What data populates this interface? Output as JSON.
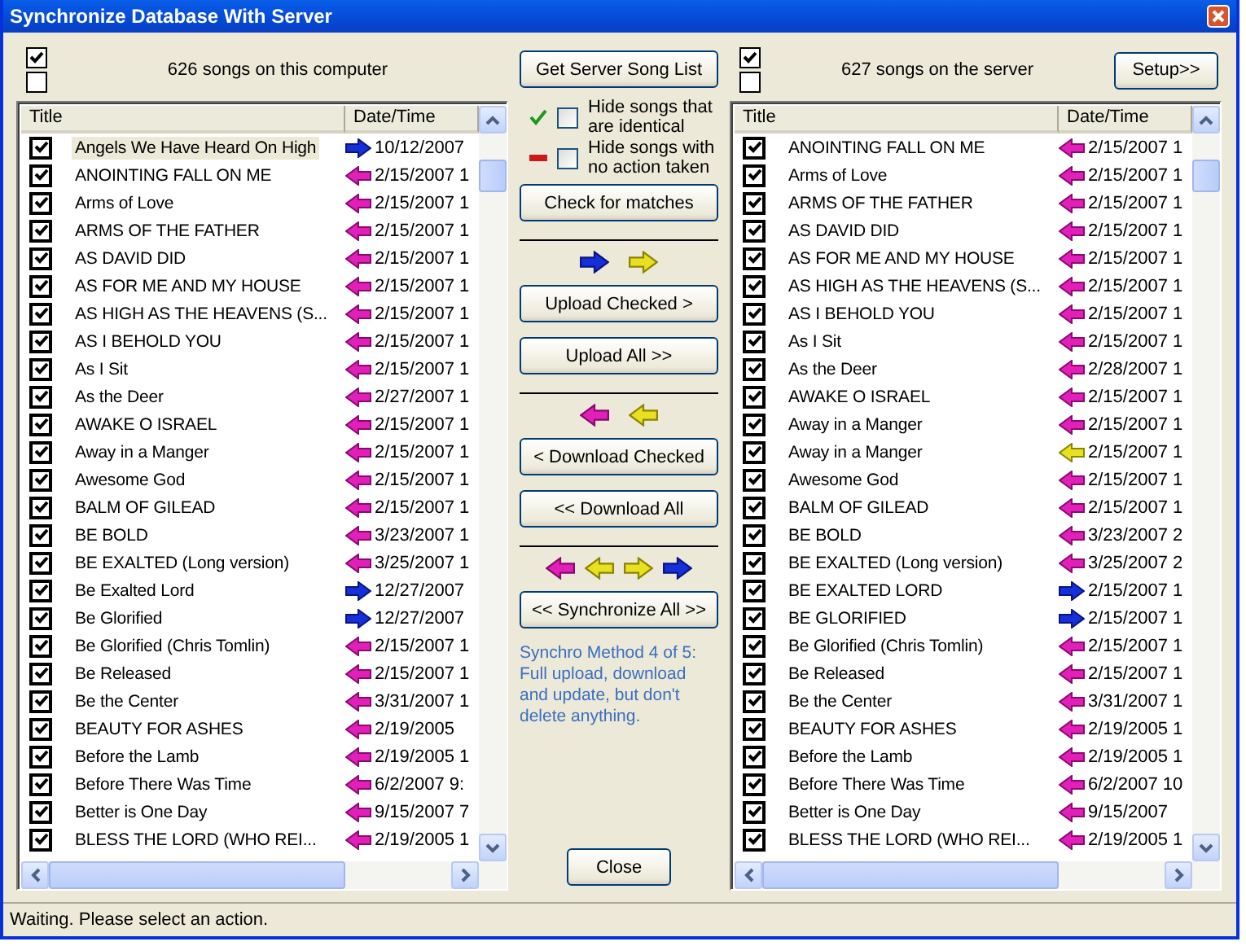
{
  "window": {
    "title": "Synchronize Database With Server"
  },
  "local": {
    "select_boxes": [
      {
        "checked": true
      },
      {
        "checked": false
      }
    ],
    "count": "626 songs on this computer",
    "columns": [
      "Title",
      "Date/Time"
    ],
    "rows": [
      {
        "title": "Angels We Have Heard On High",
        "kind": "upload",
        "date": "10/12/2007",
        "checked": true,
        "selected": true
      },
      {
        "title": "ANOINTING FALL ON ME",
        "kind": "download",
        "date": "2/15/2007 1",
        "checked": true,
        "selected": false
      },
      {
        "title": "Arms of Love",
        "kind": "download",
        "date": "2/15/2007 1",
        "checked": true,
        "selected": false
      },
      {
        "title": "ARMS OF THE FATHER",
        "kind": "download",
        "date": "2/15/2007 1",
        "checked": true,
        "selected": false
      },
      {
        "title": "AS DAVID DID",
        "kind": "download",
        "date": "2/15/2007 1",
        "checked": true,
        "selected": false
      },
      {
        "title": "AS FOR ME AND MY HOUSE",
        "kind": "download",
        "date": "2/15/2007 1",
        "checked": true,
        "selected": false
      },
      {
        "title": "AS HIGH AS THE HEAVENS (S...",
        "kind": "download",
        "date": "2/15/2007 1",
        "checked": true,
        "selected": false
      },
      {
        "title": "AS I BEHOLD YOU",
        "kind": "download",
        "date": "2/15/2007 1",
        "checked": true,
        "selected": false
      },
      {
        "title": "As I Sit",
        "kind": "download",
        "date": "2/15/2007 1",
        "checked": true,
        "selected": false
      },
      {
        "title": "As the Deer",
        "kind": "download",
        "date": "2/27/2007 1",
        "checked": true,
        "selected": false
      },
      {
        "title": "AWAKE O ISRAEL",
        "kind": "download",
        "date": "2/15/2007 1",
        "checked": true,
        "selected": false
      },
      {
        "title": "Away in a Manger",
        "kind": "download",
        "date": "2/15/2007 1",
        "checked": true,
        "selected": false
      },
      {
        "title": "Awesome God",
        "kind": "download",
        "date": "2/15/2007 1",
        "checked": true,
        "selected": false
      },
      {
        "title": "BALM OF GILEAD",
        "kind": "download",
        "date": "2/15/2007 1",
        "checked": true,
        "selected": false
      },
      {
        "title": "BE BOLD",
        "kind": "download",
        "date": "3/23/2007 1",
        "checked": true,
        "selected": false
      },
      {
        "title": "BE EXALTED (Long version)",
        "kind": "download",
        "date": "3/25/2007 1",
        "checked": true,
        "selected": false
      },
      {
        "title": "Be Exalted Lord",
        "kind": "upload",
        "date": "12/27/2007",
        "checked": true,
        "selected": false
      },
      {
        "title": "Be Glorified",
        "kind": "upload",
        "date": "12/27/2007",
        "checked": true,
        "selected": false
      },
      {
        "title": "Be Glorified (Chris Tomlin)",
        "kind": "download",
        "date": "2/15/2007 1",
        "checked": true,
        "selected": false
      },
      {
        "title": "Be Released",
        "kind": "download",
        "date": "2/15/2007 1",
        "checked": true,
        "selected": false
      },
      {
        "title": "Be the Center",
        "kind": "download",
        "date": "3/31/2007 1",
        "checked": true,
        "selected": false
      },
      {
        "title": "BEAUTY FOR ASHES",
        "kind": "download",
        "date": "2/19/2005",
        "checked": true,
        "selected": false
      },
      {
        "title": "Before the Lamb",
        "kind": "download",
        "date": "2/19/2005 1",
        "checked": true,
        "selected": false
      },
      {
        "title": "Before There Was Time",
        "kind": "download",
        "date": "6/2/2007 9:",
        "checked": true,
        "selected": false
      },
      {
        "title": "Better is One Day",
        "kind": "download",
        "date": "9/15/2007 7",
        "checked": true,
        "selected": false
      },
      {
        "title": "BLESS THE LORD (WHO REI...",
        "kind": "download",
        "date": "2/19/2005 1",
        "checked": true,
        "selected": false
      }
    ]
  },
  "middle": {
    "get_button": "Get Server Song List",
    "filters": [
      {
        "kind": "check",
        "label": "Hide songs that are identical",
        "checked": false
      },
      {
        "kind": "dash",
        "label": "Hide songs with no action taken",
        "checked": false
      }
    ],
    "check_button": "Check for matches",
    "sections": [
      {
        "arrows": [
          {
            "kind": "upload"
          },
          {
            "kind": "update-up"
          }
        ],
        "buttons": [
          "Upload Checked >",
          "Upload All >>"
        ]
      },
      {
        "arrows": [
          {
            "kind": "download"
          },
          {
            "kind": "update-down"
          }
        ],
        "buttons": [
          "< Download Checked",
          "<< Download All"
        ]
      },
      {
        "arrows": [
          {
            "kind": "download"
          },
          {
            "kind": "update-down"
          },
          {
            "kind": "update-up"
          },
          {
            "kind": "upload"
          }
        ],
        "buttons": [
          "<< Synchronize All >>"
        ]
      }
    ],
    "note": "Synchro Method 4 of 5: Full upload, download and update, but don't delete anything.",
    "close_button": "Close"
  },
  "server": {
    "select_boxes": [
      {
        "checked": true
      },
      {
        "checked": false
      }
    ],
    "count": "627 songs on the server",
    "setup_button": "Setup>>",
    "columns": [
      "Title",
      "Date/Time"
    ],
    "rows": [
      {
        "title": "ANOINTING FALL ON ME",
        "kind": "download",
        "date": "2/15/2007 1",
        "checked": true,
        "selected": false
      },
      {
        "title": "Arms of Love",
        "kind": "download",
        "date": "2/15/2007 1",
        "checked": true,
        "selected": false
      },
      {
        "title": "ARMS OF THE FATHER",
        "kind": "download",
        "date": "2/15/2007 1",
        "checked": true,
        "selected": false
      },
      {
        "title": "AS DAVID DID",
        "kind": "download",
        "date": "2/15/2007 1",
        "checked": true,
        "selected": false
      },
      {
        "title": "AS FOR ME AND MY HOUSE",
        "kind": "download",
        "date": "2/15/2007 1",
        "checked": true,
        "selected": false
      },
      {
        "title": "AS HIGH AS THE HEAVENS (S...",
        "kind": "download",
        "date": "2/15/2007 1",
        "checked": true,
        "selected": false
      },
      {
        "title": "AS I BEHOLD YOU",
        "kind": "download",
        "date": "2/15/2007 1",
        "checked": true,
        "selected": false
      },
      {
        "title": "As I Sit",
        "kind": "download",
        "date": "2/15/2007 1",
        "checked": true,
        "selected": false
      },
      {
        "title": "As the Deer",
        "kind": "download",
        "date": "2/28/2007 1",
        "checked": true,
        "selected": false
      },
      {
        "title": "AWAKE O ISRAEL",
        "kind": "download",
        "date": "2/15/2007 1",
        "checked": true,
        "selected": false
      },
      {
        "title": "Away in a Manger",
        "kind": "download",
        "date": "2/15/2007 1",
        "checked": true,
        "selected": false
      },
      {
        "title": "Away in a Manger",
        "kind": "update-down",
        "date": "2/15/2007 1",
        "checked": true,
        "selected": false
      },
      {
        "title": "Awesome God",
        "kind": "download",
        "date": "2/15/2007 1",
        "checked": true,
        "selected": false
      },
      {
        "title": "BALM OF GILEAD",
        "kind": "download",
        "date": "2/15/2007 1",
        "checked": true,
        "selected": false
      },
      {
        "title": "BE BOLD",
        "kind": "download",
        "date": "3/23/2007 2",
        "checked": true,
        "selected": false
      },
      {
        "title": "BE EXALTED (Long version)",
        "kind": "download",
        "date": "3/25/2007 2",
        "checked": true,
        "selected": false
      },
      {
        "title": "BE EXALTED LORD",
        "kind": "upload",
        "date": "2/15/2007 1",
        "checked": true,
        "selected": false
      },
      {
        "title": "BE GLORIFIED",
        "kind": "upload",
        "date": "2/15/2007 1",
        "checked": true,
        "selected": false
      },
      {
        "title": "Be Glorified (Chris Tomlin)",
        "kind": "download",
        "date": "2/15/2007 1",
        "checked": true,
        "selected": false
      },
      {
        "title": "Be Released",
        "kind": "download",
        "date": "2/15/2007 1",
        "checked": true,
        "selected": false
      },
      {
        "title": "Be the Center",
        "kind": "download",
        "date": "3/31/2007 1",
        "checked": true,
        "selected": false
      },
      {
        "title": "BEAUTY FOR ASHES",
        "kind": "download",
        "date": "2/19/2005 1",
        "checked": true,
        "selected": false
      },
      {
        "title": "Before the Lamb",
        "kind": "download",
        "date": "2/19/2005 1",
        "checked": true,
        "selected": false
      },
      {
        "title": "Before There Was Time",
        "kind": "download",
        "date": "6/2/2007 10",
        "checked": true,
        "selected": false
      },
      {
        "title": "Better is One Day",
        "kind": "download",
        "date": "9/15/2007",
        "checked": true,
        "selected": false
      },
      {
        "title": "BLESS THE LORD (WHO REI...",
        "kind": "download",
        "date": "2/19/2005 1",
        "checked": true,
        "selected": false
      }
    ]
  },
  "status_bar": "Waiting. Please select an action."
}
